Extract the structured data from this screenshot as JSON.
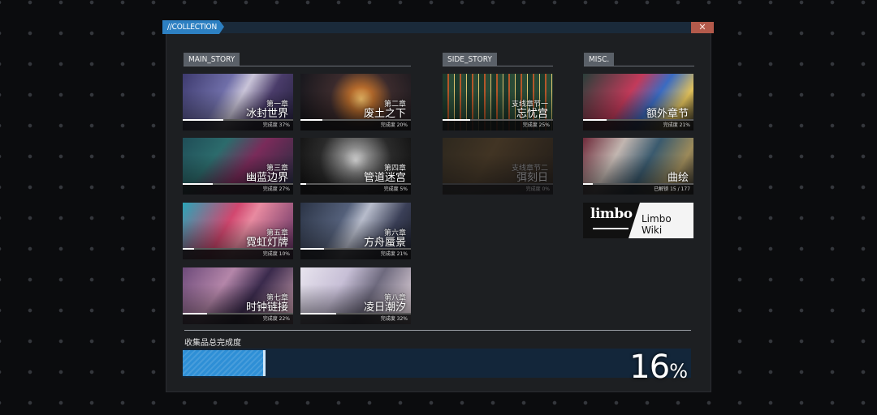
{
  "window": {
    "title": "//COLLECTION",
    "close_icon": "close-icon",
    "close_glyph": "✕"
  },
  "sections": {
    "main_story": "MAIN_STORY",
    "side_story": "SIDE_STORY",
    "misc": "MISC."
  },
  "main_story": [
    {
      "chapter": "第一章",
      "name": "冰封世界",
      "progress_label": "完成度 37%",
      "progress": 0.37,
      "art": "linear-gradient(120deg,#3d3a6e 0%,#6f6ea8 35%,#c9c4d8 50%,#4a3c6a 70%,#231f3c 100%)"
    },
    {
      "chapter": "第二章",
      "name": "废土之下",
      "progress_label": "完成度 20%",
      "progress": 0.2,
      "art": "radial-gradient(circle at 55% 45%,#f2c06a 0%,#b46a2c 18%,#3a2a2c 45%,#15161c 100%)"
    },
    {
      "chapter": "第三章",
      "name": "幽蓝边界",
      "progress_label": "完成度 27%",
      "progress": 0.27,
      "art": "linear-gradient(130deg,#1f4d57 0%,#2c6b6c 30%,#7a2b5a 55%,#1b2c3e 100%)"
    },
    {
      "chapter": "第四章",
      "name": "管道迷宫",
      "progress_label": "完成度 5%",
      "progress": 0.05,
      "art": "radial-gradient(circle at 50% 40%,#d6d6d6 0%,#8a8a8a 20%,#2a2a2a 55%,#111 100%)"
    },
    {
      "chapter": "第五章",
      "name": "霓虹灯牌",
      "progress_label": "完成度 10%",
      "progress": 0.1,
      "art": "linear-gradient(120deg,#2aa5b8 0%,#d1476f 40%,#e88aa0 55%,#5a2a5e 100%)"
    },
    {
      "chapter": "第六章",
      "name": "方舟蜃景",
      "progress_label": "完成度 21%",
      "progress": 0.21,
      "art": "linear-gradient(120deg,#2b3446 0%,#54607a 35%,#b7bccb 50%,#3a3f57 75%,#1a1d28 100%)"
    },
    {
      "chapter": "第七章",
      "name": "时钟链接",
      "progress_label": "完成度 22%",
      "progress": 0.22,
      "art": "linear-gradient(125deg,#6d4a7a 0%,#b486a9 35%,#3a2a4c 60%,#d3a6b4 100%)"
    },
    {
      "chapter": "第八章",
      "name": "凌日潮汐",
      "progress_label": "完成度 32%",
      "progress": 0.32,
      "art": "linear-gradient(120deg,#e8e4ee 0%,#c7bfd6 35%,#6e6a7e 60%,#f3e3ea 100%)"
    }
  ],
  "side_story": [
    {
      "chapter": "支线章节一",
      "name": "忘忧宫",
      "progress_label": "完成度 25%",
      "progress": 0.25,
      "art": "repeating-linear-gradient(90deg,#1d3a2c 0 6px,#b4562a 6px 8px,#2a4a36 8px 14px,#e0c270 14px 15px)"
    },
    {
      "chapter": "支线章节二",
      "name": "弭刻日",
      "progress_label": "完成度 0%",
      "progress": 0.0,
      "art": "linear-gradient(120deg,#5a4a2c 0%,#8c6a3a 40%,#3a2c1c 100%)",
      "locked": true
    }
  ],
  "misc": [
    {
      "name": "额外章节",
      "progress_label": "完成度 21%",
      "progress": 0.21,
      "art": "linear-gradient(125deg,#2a3f3a 0%,#c23a5a 40%,#3a6bc2 60%,#e0c05a 80%,#222 100%)"
    },
    {
      "name": "曲绘",
      "progress_label": "已解锁 15 / 177",
      "progress": 0.085,
      "art": "linear-gradient(120deg,#6e2a3a 0%,#c2b6b0 30%,#3a5a6e 55%,#9c8a5a 80%,#2a2a2a 100%)"
    }
  ],
  "wiki": {
    "logo": "limbo",
    "label": "Limbo Wiki"
  },
  "total": {
    "label": "收集品总完成度",
    "value": "16",
    "unit": "%",
    "progress": 0.16
  },
  "colors": {
    "accent": "#2d80c2",
    "fill": "#2e8fd6",
    "close": "#b35a4b"
  }
}
